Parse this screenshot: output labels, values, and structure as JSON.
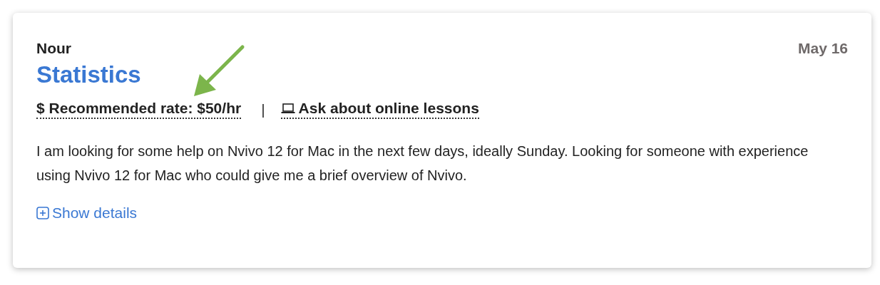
{
  "card": {
    "author": "Nour",
    "date": "May 16",
    "subject": "Statistics",
    "rate": {
      "symbol": "$",
      "label": "Recommended rate: $50/hr"
    },
    "separator": "|",
    "online": {
      "label": "Ask about online lessons"
    },
    "description": "I am looking for some help on Nvivo 12 for Mac in the next few days, ideally Sunday. Looking for someone with experience using Nvivo 12 for Mac who could give me a brief overview of Nvivo.",
    "details_link": {
      "label": "Show details",
      "expanded": false
    }
  },
  "annotation": {
    "kind": "arrow",
    "color": "#7cb54b"
  }
}
